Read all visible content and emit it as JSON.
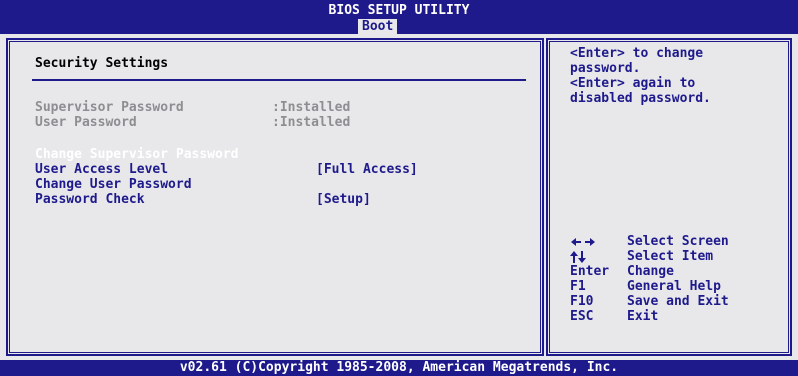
{
  "header": {
    "title": "BIOS SETUP UTILITY",
    "active_tab": "Boot"
  },
  "main": {
    "section_title": "Security Settings",
    "status": [
      {
        "label": "Supervisor Password",
        "value": ":Installed"
      },
      {
        "label": "User Password",
        "value": ":Installed"
      }
    ],
    "items": [
      {
        "label": "Change Supervisor Password",
        "value": ""
      },
      {
        "label": "User Access Level",
        "value": "[Full Access]"
      },
      {
        "label": "Change User Password",
        "value": ""
      },
      {
        "label": "Password Check",
        "value": "[Setup]"
      }
    ]
  },
  "help": {
    "lines": [
      "<Enter> to change",
      "password.",
      "<Enter> again to",
      "disabled password."
    ]
  },
  "keys": [
    {
      "key": "",
      "icon": "left-right-arrows-icon",
      "desc": "Select Screen"
    },
    {
      "key": "",
      "icon": "up-down-arrows-icon",
      "desc": "Select Item"
    },
    {
      "key": "Enter",
      "desc": "Change"
    },
    {
      "key": "F1",
      "desc": "General Help"
    },
    {
      "key": "F10",
      "desc": "Save and Exit"
    },
    {
      "key": "ESC",
      "desc": "Exit"
    }
  ],
  "footer": {
    "copyright": "v02.61 (C)Copyright 1985-2008, American Megatrends, Inc."
  },
  "colors": {
    "background": "#1e1a8c",
    "panel": "#e8e8ea",
    "selected": "#ffffff",
    "disabled": "#8e8e92"
  }
}
